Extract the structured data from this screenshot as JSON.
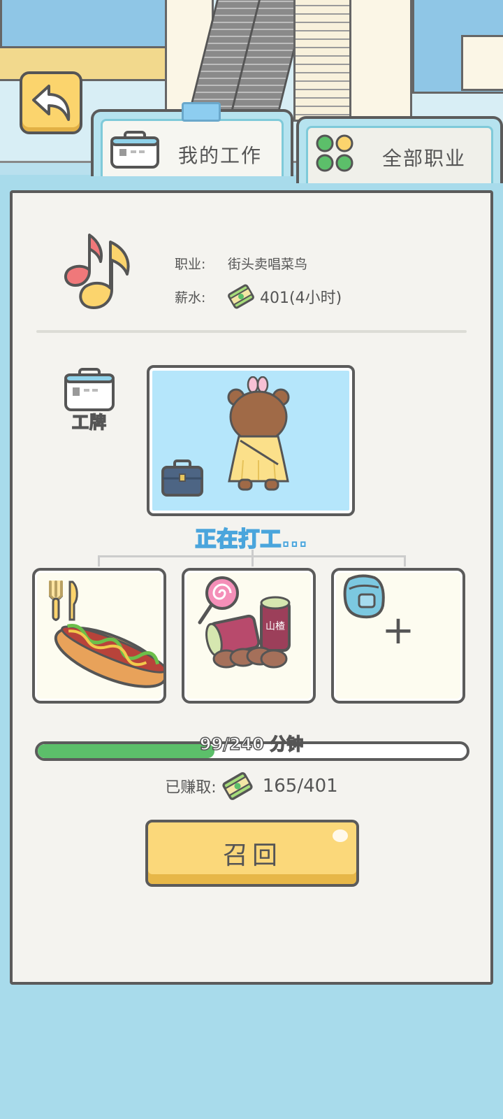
{
  "tabs": [
    {
      "label": "我的工作",
      "icon": "badge-icon",
      "active": true
    },
    {
      "label": "全部职业",
      "icon": "grid-icon",
      "active": false
    }
  ],
  "job": {
    "icon": "music-note-icon",
    "occupation_label": "职业:",
    "occupation_value": "街头卖唱菜鸟",
    "salary_label": "薪水:",
    "salary_value": "401(4小时)"
  },
  "badge": {
    "icon": "work-badge-icon",
    "label": "工牌"
  },
  "status_text": "正在打工...",
  "slots": [
    {
      "icon": "hotdog-icon"
    },
    {
      "icon": "snacks-icon"
    },
    {
      "icon": "backpack-icon",
      "plus": "+"
    }
  ],
  "progress": {
    "text": "99/240 分钟",
    "current": 99,
    "total": 240
  },
  "earned": {
    "label": "已赚取:",
    "value": "165/401"
  },
  "recall_button": "召回",
  "colors": {
    "accent_yellow": "#fbd87a",
    "progress_green": "#5cbf6a",
    "tab_blue": "#b6e3ef",
    "status_blue": "#4aa5dc"
  }
}
